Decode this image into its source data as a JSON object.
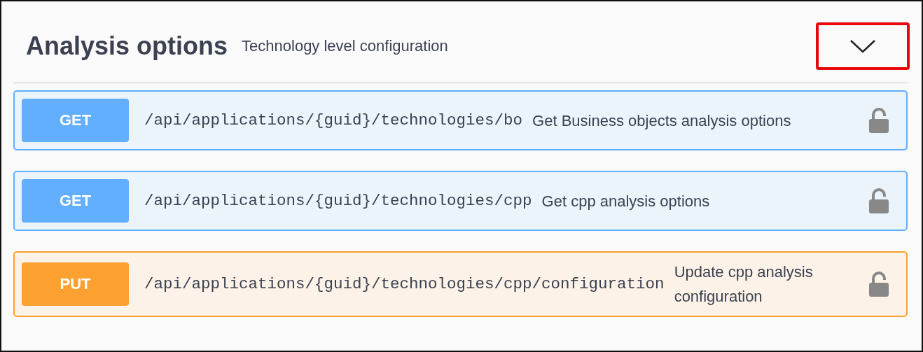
{
  "section": {
    "title": "Analysis options",
    "description": "Technology level configuration",
    "expanded": true,
    "highlighted": true
  },
  "operations": [
    {
      "kind": "get",
      "method": "GET",
      "path": "/api/applications/{guid}/technologies/bo",
      "summary": "Get Business objects analysis options",
      "locked": false
    },
    {
      "kind": "get",
      "method": "GET",
      "path": "/api/applications/{guid}/technologies/cpp",
      "summary": "Get cpp analysis options",
      "locked": false
    },
    {
      "kind": "put",
      "method": "PUT",
      "path": "/api/applications/{guid}/technologies/cpp/configuration",
      "summary": "Update cpp analysis configuration",
      "locked": false
    }
  ]
}
